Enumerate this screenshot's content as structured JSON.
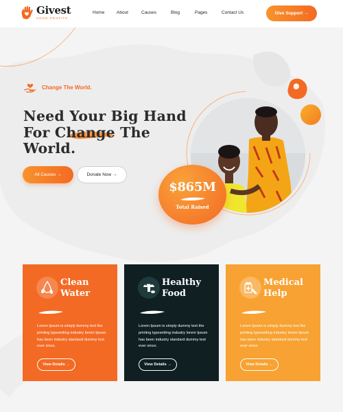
{
  "header": {
    "logo": {
      "name": "Givest",
      "tagline": "UNON-PROFITS"
    },
    "nav": [
      {
        "label": "Home"
      },
      {
        "label": "About"
      },
      {
        "label": "Causes"
      },
      {
        "label": "Blog"
      },
      {
        "label": "Pages"
      },
      {
        "label": "Contact Us"
      }
    ],
    "cta": "Give Support →"
  },
  "hero": {
    "tagline": "Change The World.",
    "title_lines": [
      "Need Your Big Hand",
      "For Change The",
      "World."
    ],
    "buttons": {
      "primary": "All Causes →",
      "secondary": "Donate Now →"
    },
    "raised": {
      "amount": "$865M",
      "label": "Total Raised"
    }
  },
  "cards": [
    {
      "title_lines": [
        "Clean",
        "Water"
      ],
      "icon": "water-drops-icon",
      "text": "Lorem Ipsum is simply dummy text the printing typesetting industry lorem Ipsum has been industry standard dummy text ever since.",
      "button": "View Details →",
      "color": "#f36a24"
    },
    {
      "title_lines": [
        "Healthy",
        "Food"
      ],
      "icon": "mushroom-food-icon",
      "text": "Lorem Ipsum is simply dummy text the printing typesetting industry lorem Ipsum has been industry standard dummy text ever since.",
      "button": "View Details →",
      "color": "#0f1f22"
    },
    {
      "title_lines": [
        "Medical",
        "Help"
      ],
      "icon": "medicine-icon",
      "text": "Lorem Ipsum is simply dummy text the printing typesetting industry lorem Ipsum has been industry standard dummy text ever since.",
      "button": "View Details →",
      "color": "#f7a232"
    }
  ],
  "colors": {
    "accent": "#f36a24",
    "accent_light": "#f8932b",
    "dark": "#0f1f22",
    "amber": "#f7a232"
  }
}
